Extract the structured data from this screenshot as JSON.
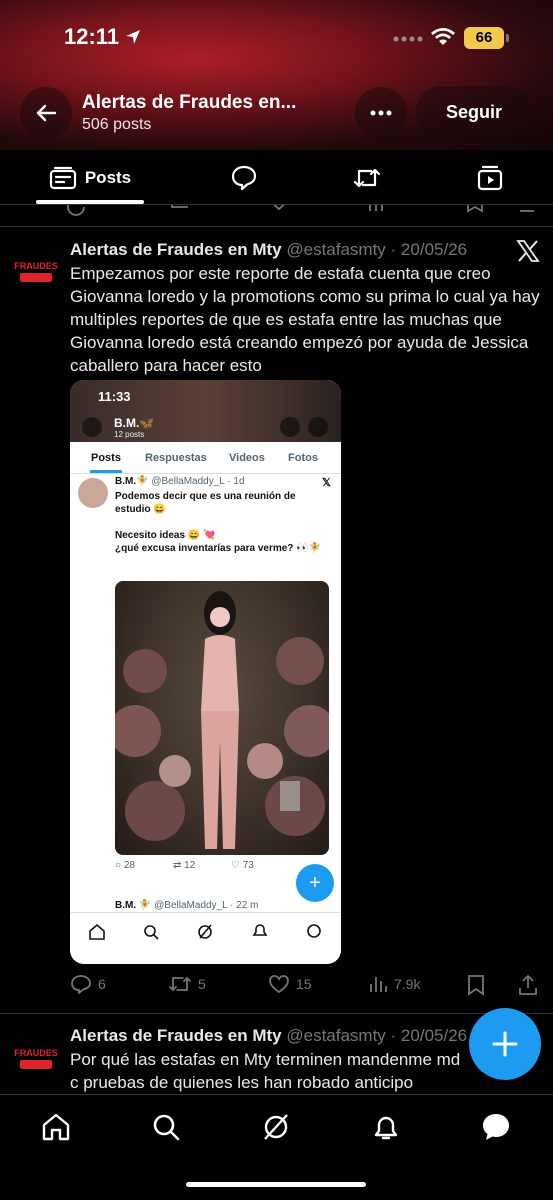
{
  "status": {
    "time": "12:11",
    "battery": "66"
  },
  "header": {
    "title": "Alertas de Fraudes en...",
    "post_count": "506 posts",
    "follow_label": "Seguir"
  },
  "tabs": [
    {
      "label": "Posts",
      "icon": "posts-icon"
    },
    {
      "icon": "replies-icon"
    },
    {
      "icon": "reposts-icon"
    },
    {
      "icon": "media-icon"
    }
  ],
  "tweet": {
    "name": "Alertas de Fraudes en Mty",
    "handle": "@estafasmty",
    "date": "· 20/05/26",
    "avatar_text": "FRAUDES",
    "text": "Empezamos por este reporte de estafa cuenta que creo Giovanna loredo y la promotions como su prima lo cual ya hay multiples reportes de que es estafa  entre las muchas que Giovanna loredo está creando empezó por ayuda de Jessica caballero para hacer esto",
    "replies": "6",
    "reposts": "5",
    "likes": "15",
    "views": "7.9k"
  },
  "embed": {
    "time": "11:33",
    "profile_name": "B.M.🦋",
    "profile_posts": "12 posts",
    "tabs": [
      "Posts",
      "Respuestas",
      "Videos",
      "Fotos"
    ],
    "post_name": "B.M.🧚",
    "post_handle": "@BellaMaddy_L · 1d",
    "post_text": "Podemos decir que es una reunión de estudio 😄\n\nNecesito ideas 😄 💘\n¿qué excusa inventarías para verme? 👀🧚",
    "replies": "28",
    "reposts": "12",
    "likes": "73",
    "next_name": "B.M. 🧚",
    "next_handle": "@BellaMaddy_L · 22 m"
  },
  "tweet2": {
    "name": "Alertas de Fraudes en Mty",
    "handle": "@estafasmty",
    "date": "· 20/05/26",
    "text": "Por qué las estafas en Mty terminen mandenme md c pruebas de quienes les han robado anticipo"
  },
  "colors": {
    "accent": "#1d9bf0",
    "banner": "#b8202a"
  }
}
